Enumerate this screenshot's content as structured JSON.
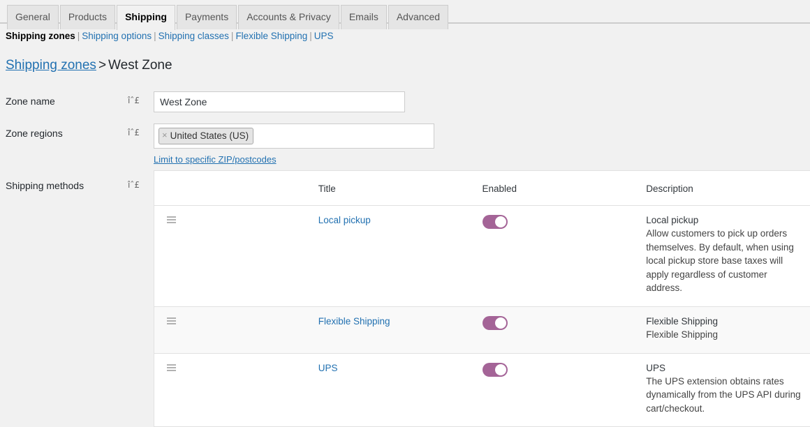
{
  "tabs": [
    {
      "label": "General",
      "active": false
    },
    {
      "label": "Products",
      "active": false
    },
    {
      "label": "Shipping",
      "active": true
    },
    {
      "label": "Payments",
      "active": false
    },
    {
      "label": "Accounts & Privacy",
      "active": false
    },
    {
      "label": "Emails",
      "active": false
    },
    {
      "label": "Advanced",
      "active": false
    }
  ],
  "subnav": {
    "items": [
      {
        "label": "Shipping zones",
        "current": true
      },
      {
        "label": "Shipping options",
        "current": false
      },
      {
        "label": "Shipping classes",
        "current": false
      },
      {
        "label": "Flexible Shipping",
        "current": false
      },
      {
        "label": "UPS",
        "current": false
      }
    ],
    "separator": "|"
  },
  "breadcrumb": {
    "parent": "Shipping zones",
    "separator": ">",
    "current": "West Zone"
  },
  "help_icon_glyph": "îˆ£",
  "form": {
    "zone_name": {
      "label": "Zone name",
      "value": "West Zone"
    },
    "zone_regions": {
      "label": "Zone regions",
      "chips": [
        "United States (US)"
      ],
      "chip_remove_glyph": "×",
      "limit_link": "Limit to specific ZIP/postcodes"
    },
    "shipping_methods": {
      "label": "Shipping methods"
    }
  },
  "methods_table": {
    "columns": [
      "",
      "Title",
      "Enabled",
      "Description"
    ],
    "rows": [
      {
        "title": "Local pickup",
        "enabled": true,
        "desc_title": "Local pickup",
        "desc_body": "Allow customers to pick up orders themselves. By default, when using local pickup store base taxes will apply regardless of customer address.",
        "striped": false
      },
      {
        "title": "Flexible Shipping",
        "enabled": true,
        "desc_title": "Flexible Shipping",
        "desc_body": "Flexible Shipping",
        "striped": true
      },
      {
        "title": "UPS",
        "enabled": true,
        "desc_title": "UPS",
        "desc_body": "The UPS extension obtains rates dynamically from the UPS API during cart/checkout.",
        "striped": false
      }
    ]
  },
  "colors": {
    "toggle_on": "#a46497",
    "link": "#2271b1",
    "page_bg": "#f1f1f1"
  }
}
